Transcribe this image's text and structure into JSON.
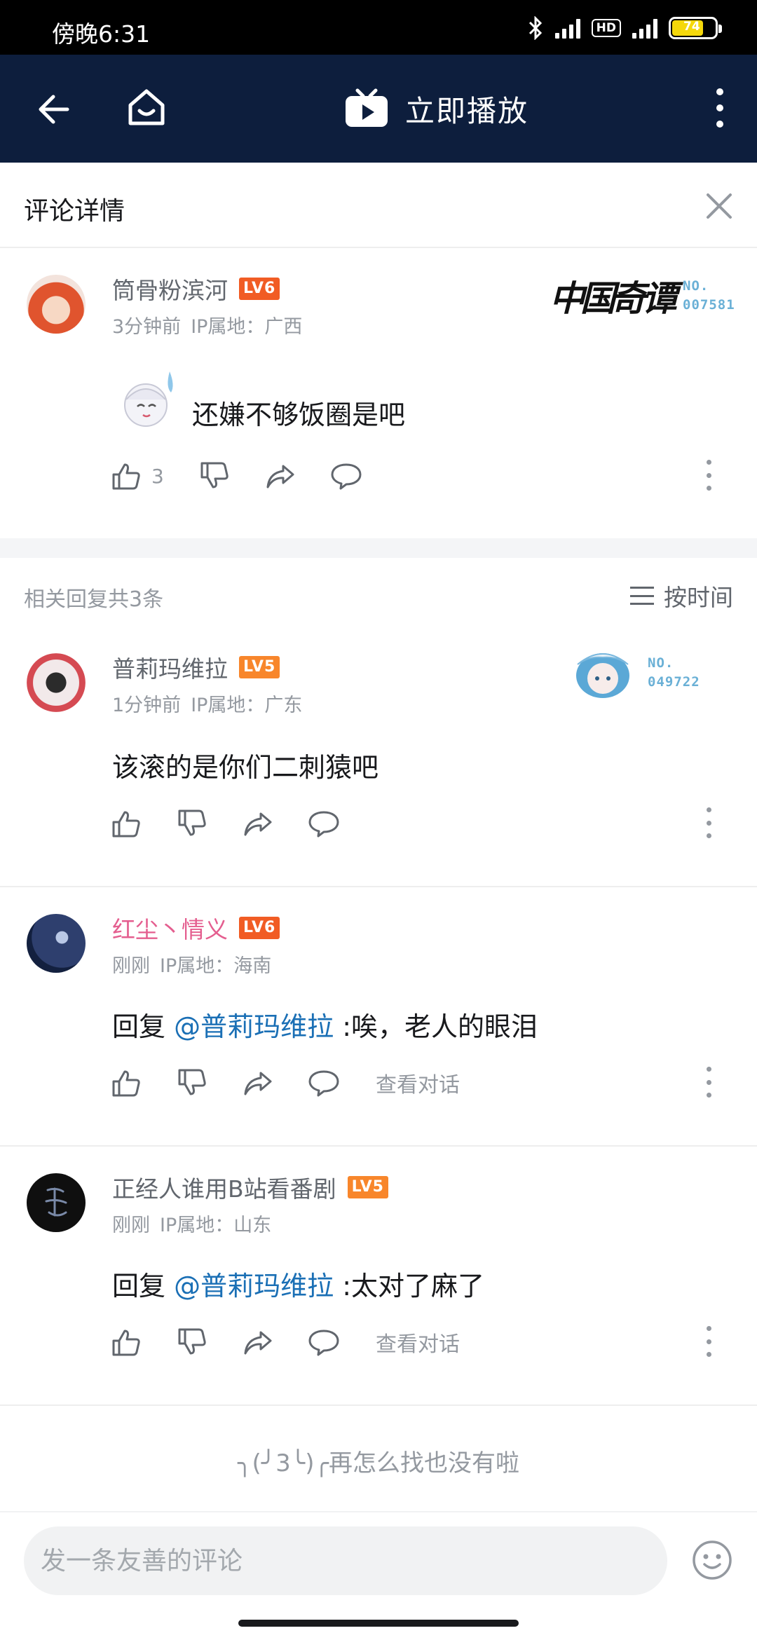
{
  "status_bar": {
    "time": "傍晚6:31",
    "battery": "74",
    "network1": "4G",
    "network2": "4G",
    "hd": "HD"
  },
  "app_bar": {
    "title": "立即播放"
  },
  "detail": {
    "title": "评论详情"
  },
  "main_comment": {
    "username": "筒骨粉滨河",
    "level": "LV6",
    "time": "3分钟前",
    "ip": "IP属地：广西",
    "text": "还嫌不够饭圈是吧",
    "likes": "3",
    "badge_title": "中国奇谭",
    "badge_no": "NO.",
    "badge_num": "007581"
  },
  "replies_header": {
    "count_label": "相关回复共3条",
    "sort_label": "按时间"
  },
  "replies": [
    {
      "username": "普莉玛维拉",
      "level": "LV5",
      "time": "1分钟前",
      "ip": "IP属地：广东",
      "text": "该滚的是你们二刺猿吧",
      "badge_no": "NO.",
      "badge_num": "049722"
    },
    {
      "username": "红尘丶情义",
      "level": "LV6",
      "time": "刚刚",
      "ip": "IP属地：海南",
      "reply_prefix": "回复 ",
      "mention": "@普莉玛维拉",
      "text": " :唉，老人的眼泪",
      "view_conversation": "查看对话"
    },
    {
      "username": "正经人谁用B站看番剧",
      "level": "LV5",
      "time": "刚刚",
      "ip": "IP属地：山东",
      "reply_prefix": "回复 ",
      "mention": "@普莉玛维拉",
      "text": " :太对了麻了",
      "view_conversation": "查看对话"
    }
  ],
  "end_text": "╮(╯3╰)╭再怎么找也没有啦",
  "comment_input": {
    "placeholder": "发一条友善的评论"
  },
  "colors": {
    "app_bar": "#0d1e3d",
    "mention": "#1a6fb5",
    "username_vip": "#e45e8f",
    "level_badge": "#f15c24"
  },
  "icons": [
    "back-icon",
    "home-icon",
    "tv-play-icon",
    "more-icon",
    "close-icon",
    "like-icon",
    "dislike-icon",
    "share-icon",
    "reply-icon",
    "sort-icon",
    "emoji-icon"
  ]
}
